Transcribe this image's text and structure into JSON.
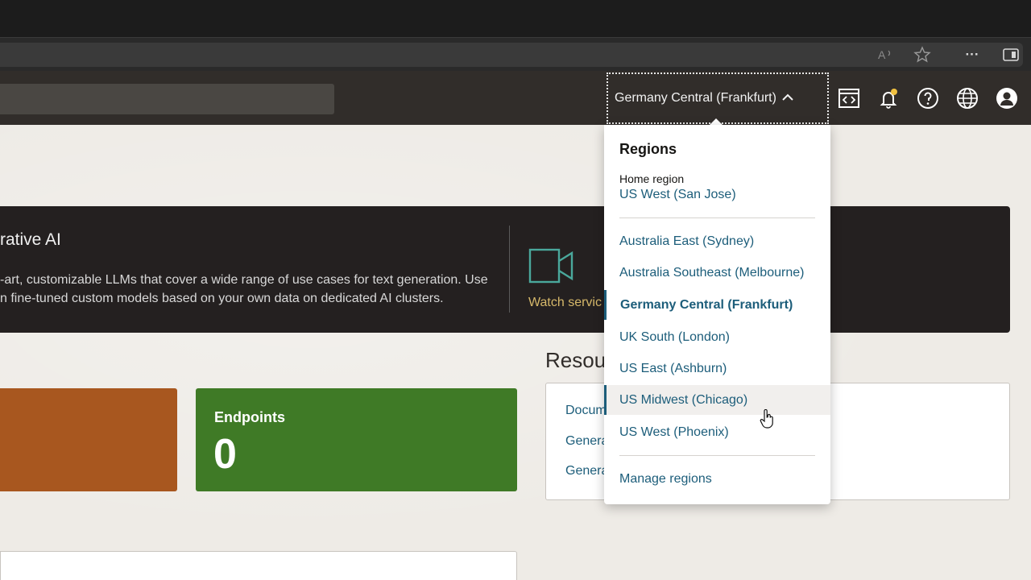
{
  "browser": {
    "icons": [
      "read-aloud-icon",
      "favorite-star-icon",
      "more-icon",
      "split-screen-icon"
    ],
    "more_glyph": "···"
  },
  "header": {
    "region_selector": {
      "label": "Germany Central (Frankfurt)",
      "expanded": true
    },
    "icons": [
      "code-editor-icon",
      "notifications-bell-icon",
      "help-icon",
      "language-globe-icon",
      "user-profile-icon"
    ],
    "notification_dot_color": "#f0c040"
  },
  "banner": {
    "title": "rative AI",
    "description_line1": "-art, customizable LLMs that cover a wide range of use cases for text generation. Use",
    "description_line2": "n fine-tuned custom models based on your own data on dedicated AI clusters.",
    "watch_link": "Watch servic"
  },
  "tiles": [
    {
      "label": "",
      "value": "",
      "color": "#a8571f"
    },
    {
      "label": "Endpoints",
      "value": "0",
      "color": "#3f7a26"
    }
  ],
  "resources": {
    "title": "Resou",
    "links": [
      "Docum",
      "Genera",
      "Genera"
    ]
  },
  "regions_dropdown": {
    "title": "Regions",
    "home_region_label": "Home region",
    "home_region_value": "US West (San Jose)",
    "regions": [
      {
        "name": "Australia East (Sydney)",
        "selected": false,
        "hovered": false
      },
      {
        "name": "Australia Southeast (Melbourne)",
        "selected": false,
        "hovered": false
      },
      {
        "name": "Germany Central (Frankfurt)",
        "selected": true,
        "hovered": false
      },
      {
        "name": "UK South (London)",
        "selected": false,
        "hovered": false
      },
      {
        "name": "US East (Ashburn)",
        "selected": false,
        "hovered": false
      },
      {
        "name": "US Midwest (Chicago)",
        "selected": false,
        "hovered": true
      },
      {
        "name": "US West (Phoenix)",
        "selected": false,
        "hovered": false
      }
    ],
    "manage_link": "Manage regions"
  },
  "colors": {
    "link": "#1c5d7a",
    "header_bg": "#312d2a",
    "banner_bg": "#242020"
  }
}
